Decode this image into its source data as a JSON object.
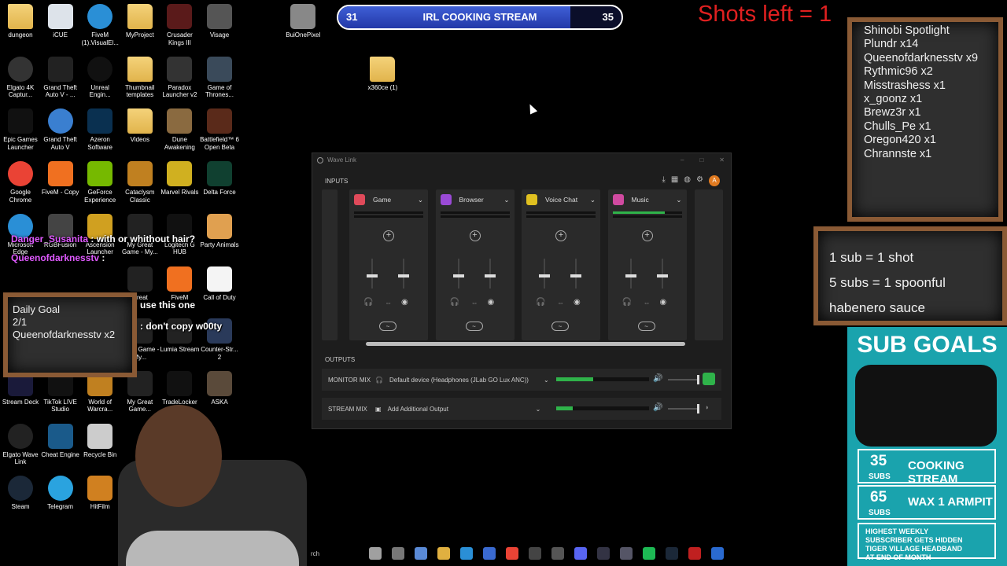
{
  "desktop_icons": [
    {
      "label": "dungeon",
      "icon": "folder-icon",
      "color": "#e8c060"
    },
    {
      "label": "iCUE",
      "icon": "app-icon",
      "color": "#dde3ea"
    },
    {
      "label": "FiveM (1).VisualEl...",
      "icon": "edge-icon",
      "color": "#2a8fd6"
    },
    {
      "label": "MyProject",
      "icon": "folder-icon",
      "color": "#e8c060"
    },
    {
      "label": "Crusader Kings III",
      "icon": "game-icon",
      "color": "#5a1a1a"
    },
    {
      "label": "Visage",
      "icon": "app-icon",
      "color": "#555555"
    },
    {
      "label": "BuiOnePixel",
      "icon": "app-icon",
      "color": "#888888"
    },
    {
      "label": "Elgato 4K Captur...",
      "icon": "elgato-icon",
      "color": "#333333"
    },
    {
      "label": "Grand Theft Auto V - ...",
      "icon": "gta-icon",
      "color": "#222222"
    },
    {
      "label": "Unreal Engin...",
      "icon": "unreal-icon",
      "color": "#111111"
    },
    {
      "label": "Thumbnail templates",
      "icon": "folder-icon",
      "color": "#e8c060"
    },
    {
      "label": "Paradox Launcher v2",
      "icon": "paradox-icon",
      "color": "#333333"
    },
    {
      "label": "Game of Thrones...",
      "icon": "game-icon",
      "color": "#3a4a5a"
    },
    {
      "label": "x360ce (1)",
      "icon": "folder-icon",
      "color": "#e8c060"
    },
    {
      "label": "Epic Games Launcher",
      "icon": "epic-icon",
      "color": "#111111"
    },
    {
      "label": "Grand Theft Auto V",
      "icon": "globe-icon",
      "color": "#3a7fd0"
    },
    {
      "label": "Azeron Software",
      "icon": "azeron-icon",
      "color": "#0a3050"
    },
    {
      "label": "Videos",
      "icon": "folder-icon",
      "color": "#e8c060"
    },
    {
      "label": "Dune Awakening",
      "icon": "game-icon",
      "color": "#8a6a40"
    },
    {
      "label": "Battlefield™ 6 Open Beta",
      "icon": "game-icon",
      "color": "#5a2a1a"
    },
    {
      "label": "Google Chrome",
      "icon": "chrome-icon",
      "color": "#ea4335"
    },
    {
      "label": "FiveM - Copy",
      "icon": "fivem-icon",
      "color": "#f07020"
    },
    {
      "label": "GeForce Experience",
      "icon": "nvidia-icon",
      "color": "#76b900"
    },
    {
      "label": "Cataclysm Classic",
      "icon": "wow-icon",
      "color": "#c08020"
    },
    {
      "label": "Marvel Rivals",
      "icon": "game-icon",
      "color": "#d0b020"
    },
    {
      "label": "Delta Force",
      "icon": "game-icon",
      "color": "#104030"
    },
    {
      "label": "Microsoft Edge",
      "icon": "edge-icon",
      "color": "#2a8fd6"
    },
    {
      "label": "RGBFusion",
      "icon": "app-icon",
      "color": "#444444"
    },
    {
      "label": "Ascension Launcher",
      "icon": "game-icon",
      "color": "#d0a020"
    },
    {
      "label": "My Great Game - My...",
      "icon": "game-icon",
      "color": "#222222"
    },
    {
      "label": "Logitech G HUB",
      "icon": "logitech-icon",
      "color": "#111111"
    },
    {
      "label": "Party Animals",
      "icon": "game-icon",
      "color": "#e0a050"
    },
    {
      "label": "Great",
      "icon": "game-icon",
      "color": "#222222"
    },
    {
      "label": "FiveM",
      "icon": "fivem-icon",
      "color": "#f07020"
    },
    {
      "label": "Call of Duty",
      "icon": "file-icon",
      "color": "#f4f4f4"
    },
    {
      "label": "Great Game - My...",
      "icon": "game-icon",
      "color": "#222222"
    },
    {
      "label": "Lumia Stream",
      "icon": "app-icon",
      "color": "#222222"
    },
    {
      "label": "Counter-Str... 2",
      "icon": "game-icon",
      "color": "#2a3a5a"
    },
    {
      "label": "Stream Deck",
      "icon": "app-icon",
      "color": "#1a1a3a"
    },
    {
      "label": "TikTok LIVE Studio",
      "icon": "tiktok-icon",
      "color": "#111111"
    },
    {
      "label": "World of Warcra...",
      "icon": "wow-icon",
      "color": "#c08020"
    },
    {
      "label": "My Great Game...",
      "icon": "game-icon",
      "color": "#222222"
    },
    {
      "label": "TradeLocker",
      "icon": "app-icon",
      "color": "#111111"
    },
    {
      "label": "ASKA",
      "icon": "game-icon",
      "color": "#5a4a3a"
    },
    {
      "label": "Elgato Wave Link",
      "icon": "wave-icon",
      "color": "#222222"
    },
    {
      "label": "Cheat Engine",
      "icon": "app-icon",
      "color": "#1a5a8a"
    },
    {
      "label": "Recycle Bin",
      "icon": "recycle-icon",
      "color": "#cccccc"
    },
    {
      "label": "Steam",
      "icon": "steam-icon",
      "color": "#1b2838"
    },
    {
      "label": "Telegram",
      "icon": "telegram-icon",
      "color": "#2aa3df"
    },
    {
      "label": "HitFilm",
      "icon": "app-icon",
      "color": "#d08020"
    }
  ],
  "chat": [
    {
      "user": "Danger_Susanita",
      "text": ": with or whithout hair?"
    },
    {
      "user": "Queenofdarknesstv",
      "text": ":"
    },
    {
      "user": "",
      "text": "use this one"
    },
    {
      "user": "",
      "text": ": don't copy w00ty"
    }
  ],
  "progress": {
    "start": "31",
    "title": "IRL COOKING STREAM",
    "end": "35",
    "fill_fraction": 0.82,
    "color": "#2f4ec4"
  },
  "shots": "Shots left = 1",
  "spotlight": {
    "lines": [
      "Shinobi Spotlight",
      "Plundr x14",
      "Queenofdarknesstv x9",
      "Rythmic96 x2",
      "Misstrashess x1",
      "x_goonz x1",
      "Brewz3r x1",
      "Chulls_Pe x1",
      "Oregon420 x1",
      "Chrannste x1"
    ]
  },
  "rules": {
    "lines": [
      "1 sub = 1 shot",
      "5 subs = 1 spoonful habenero sauce"
    ]
  },
  "daily_goal": {
    "lines": [
      "Daily Goal",
      "2/1",
      "Queenofdarknesstv x2"
    ]
  },
  "wavelink": {
    "title": "Wave Link",
    "inputs_label": "INPUTS",
    "outputs_label": "OUTPUTS",
    "channels": [
      {
        "name": "Game",
        "color": "#e04a5a",
        "meter": 0
      },
      {
        "name": "Browser",
        "color": "#9a4ad6",
        "meter": 0
      },
      {
        "name": "Voice Chat",
        "color": "#e0c020",
        "meter": 0
      },
      {
        "name": "Music",
        "color": "#d04aa0",
        "meter": 0.75
      }
    ],
    "profile_initial": "A",
    "monitor_mix": {
      "label": "MONITOR MIX",
      "device": "Default device (Headphones (JLab GO Lux ANC))",
      "level": 0.4
    },
    "stream_mix": {
      "label": "STREAM MIX",
      "device": "Add Additional Output",
      "level": 0.18
    }
  },
  "sub_goals": {
    "title": "SUB GOALS",
    "goals": [
      {
        "num": "35",
        "sub": "SUBS",
        "label": "COOKING STREAM"
      },
      {
        "num": "65",
        "sub": "SUBS",
        "label": "WAX 1 ARMPIT"
      }
    ],
    "footer": "HIGHEST WEEKLY SUBSCRIBER GETS HIDDEN TIGER VILLAGE HEADBAND AT END OF MONTH"
  },
  "taskbar": {
    "search": "rch",
    "items": [
      "browser-icon",
      "task-view-icon",
      "copilot-icon",
      "files-icon",
      "edge-icon",
      "store-icon",
      "chrome-icon",
      "camera-icon",
      "app-icon",
      "discord-icon",
      "elgato-icon",
      "app-icon",
      "spotify-icon",
      "steam-icon",
      "app-icon",
      "app-icon"
    ]
  }
}
